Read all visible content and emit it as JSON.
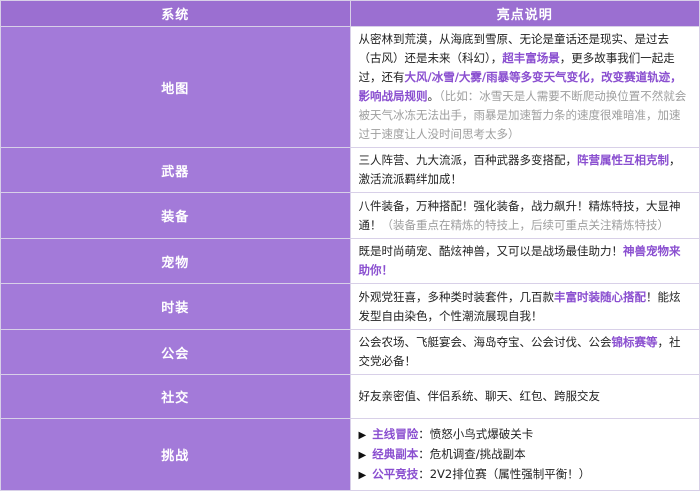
{
  "header": {
    "system": "系统",
    "highlights": "亮点说明"
  },
  "rows": {
    "map": {
      "label": "地图",
      "p1": "从密林到荒漠，从海底到雪原、无论是童话还是现实、是过去（古风）还是未来（科幻），",
      "h1": "超丰富场景",
      "p2": "，更多故事我们一起走过，还有",
      "h2": "大风/冰雪/大雾/雨暴等多变天气变化，改变赛道轨迹，影响战局规则",
      "p3": "。",
      "note": "（比如：冰雪天是人需要不断爬动换位置不然就会被天气冰冻无法出手，雨暴是加速暂力条的速度很难暗准，加速过于速度让人没时间思考太多）"
    },
    "weapon": {
      "label": "武器",
      "p1": "三人阵营、九大流派，百种武器多变搭配，",
      "h1": "阵营属性互相克制",
      "p2": "，激活流派羁绊加成！"
    },
    "equipment": {
      "label": "装备",
      "p1": "八件装备，万种搭配！强化装备，战力飙升！精炼特技，大显神通！",
      "note": "（装备重点在精炼的特技上，后续可重点关注精炼特技）"
    },
    "pet": {
      "label": "宠物",
      "p1": "既是时尚萌宠、酷炫神兽，又可以是战场最佳助力！",
      "h1": "神兽宠物来助你！"
    },
    "costume": {
      "label": "时装",
      "p1": "外观党狂喜，多种类时装套件，几百款",
      "h1": "丰富时装随心搭配",
      "p2": "！能炫发型自由染色，个性潮流展现自我！"
    },
    "guild": {
      "label": "公会",
      "p1": "公会农场、飞艇宴会、海岛夺宝、公会讨伐、公会",
      "h1": "锦标赛等",
      "p2": "，社交党必备！"
    },
    "social": {
      "label": "社交",
      "p1": "好友亲密值、伴侣系统、聊天、红包、跨服交友"
    },
    "challenge": {
      "label": "挑战",
      "arrow": "▶",
      "items": [
        {
          "hl": "主线冒险",
          "text": "：愤怒小鸟式爆破关卡"
        },
        {
          "hl": "经典副本",
          "text": "：危机调查/挑战副本"
        },
        {
          "hl": "公平竞技",
          "text": "：2V2排位赛（属性强制平衡！）"
        }
      ]
    }
  }
}
